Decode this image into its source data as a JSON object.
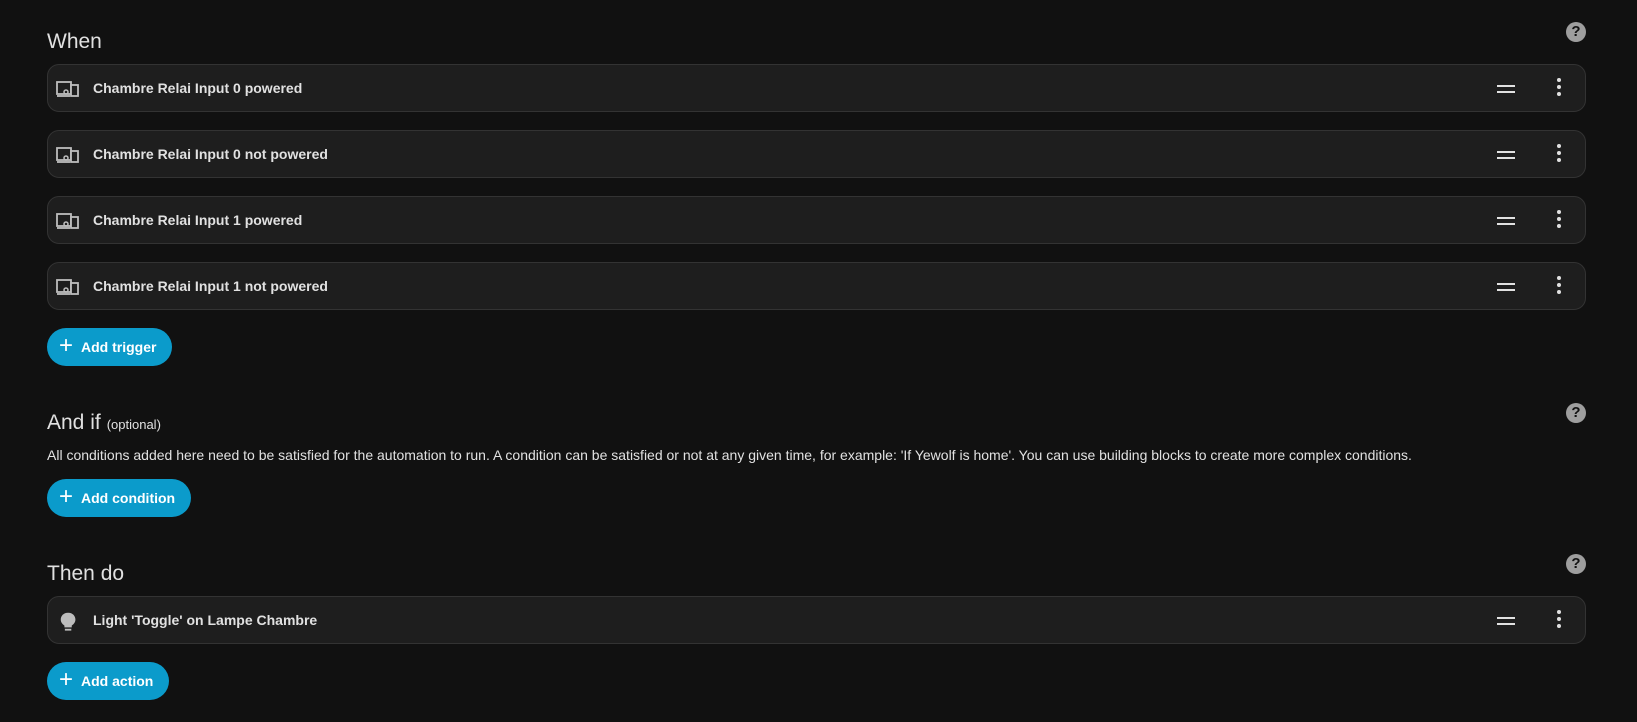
{
  "when": {
    "title": "When",
    "help_icon": "help-circle-icon",
    "triggers": [
      {
        "label": "Chambre Relai Input 0 powered",
        "icon": "device-icon"
      },
      {
        "label": "Chambre Relai Input 0 not powered",
        "icon": "device-icon"
      },
      {
        "label": "Chambre Relai Input 1 powered",
        "icon": "device-icon"
      },
      {
        "label": "Chambre Relai Input 1 not powered",
        "icon": "device-icon"
      }
    ],
    "add_label": "Add trigger"
  },
  "and_if": {
    "title": "And if",
    "optional": "(optional)",
    "help_icon": "help-circle-icon",
    "description": "All conditions added here need to be satisfied for the automation to run. A condition can be satisfied or not at any given time, for example: 'If Yewolf is home'. You can use building blocks to create more complex conditions.",
    "add_label": "Add condition"
  },
  "then_do": {
    "title": "Then do",
    "help_icon": "help-circle-icon",
    "actions": [
      {
        "label": "Light 'Toggle' on Lampe Chambre",
        "icon": "lightbulb-icon"
      }
    ],
    "add_label": "Add action"
  },
  "colors": {
    "background": "#111111",
    "card": "#1e1e1e",
    "accent": "#0b9bcb",
    "text": "#e1e1e1"
  }
}
